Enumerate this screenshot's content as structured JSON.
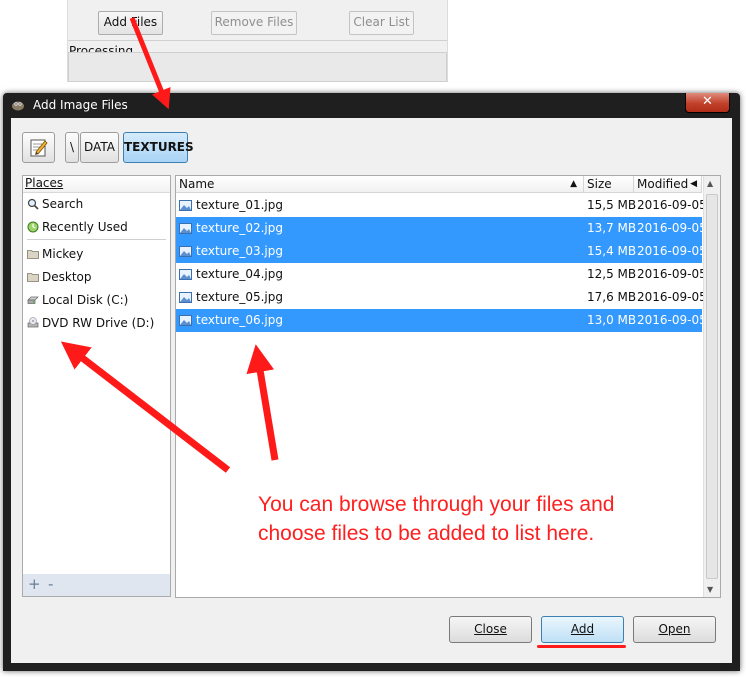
{
  "background_app": {
    "buttons": [
      {
        "label": "Add Files",
        "enabled": true
      },
      {
        "label": "Remove Files",
        "enabled": false
      },
      {
        "label": "Clear List",
        "enabled": false
      }
    ],
    "processing_label": "Processing"
  },
  "dialog": {
    "title": "Add Image Files",
    "close_glyph": "✕",
    "path": [
      "\\",
      "DATA",
      "TEXTURES"
    ],
    "places": {
      "header": "Places",
      "items": [
        {
          "label": "Search",
          "icon": "search-icon"
        },
        {
          "label": "Recently Used",
          "icon": "clock-icon"
        },
        {
          "label": "Mickey",
          "icon": "folder-icon"
        },
        {
          "label": "Desktop",
          "icon": "folder-icon"
        },
        {
          "label": "Local Disk (C:)",
          "icon": "drive-icon"
        },
        {
          "label": "DVD RW Drive (D:)",
          "icon": "dvd-drive-icon"
        }
      ],
      "add_glyph": "+",
      "remove_glyph": "-"
    },
    "files": {
      "columns": {
        "name": "Name",
        "size": "Size",
        "modified": "Modified"
      },
      "rows": [
        {
          "name": "texture_01.jpg",
          "size": "15,5 MB",
          "modified": "2016-09-05",
          "selected": false
        },
        {
          "name": "texture_02.jpg",
          "size": "13,7 MB",
          "modified": "2016-09-05",
          "selected": true
        },
        {
          "name": "texture_03.jpg",
          "size": "15,4 MB",
          "modified": "2016-09-05",
          "selected": true
        },
        {
          "name": "texture_04.jpg",
          "size": "12,5 MB",
          "modified": "2016-09-05",
          "selected": false
        },
        {
          "name": "texture_05.jpg",
          "size": "17,6 MB",
          "modified": "2016-09-05",
          "selected": false
        },
        {
          "name": "texture_06.jpg",
          "size": "13,0 MB",
          "modified": "2016-09-05",
          "selected": true
        }
      ]
    },
    "buttons": {
      "close": "Close",
      "add": "Add",
      "open": "Open"
    }
  },
  "annotation": {
    "text_line1": "You can browse through your files and",
    "text_line2": "choose files to be added to list here.",
    "color": "#ff1f1f"
  },
  "colors": {
    "selection": "#3399ff",
    "title_bar": "#1f1f1f",
    "dialog_bg": "#f0f0f0"
  }
}
